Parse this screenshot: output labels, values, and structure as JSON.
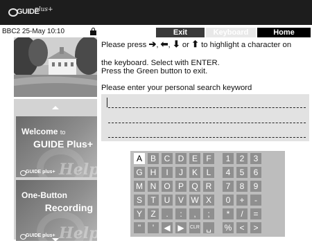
{
  "header": {
    "logo_text": "GUIDE",
    "logo_plus": "plus+"
  },
  "status": {
    "channel_date_time": "BBC2  25-May 10:10"
  },
  "tabs": [
    {
      "label": "Exit"
    },
    {
      "label": "Keyboard"
    },
    {
      "label": "Home"
    }
  ],
  "instruction": {
    "press": "Please press",
    "comma1": ",",
    "comma2": ",",
    "or": "or",
    "rest_line": "to highlight a character on",
    "line2": "the keyboard. Select with ENTER.",
    "line3": "Press the Green button to exit."
  },
  "prompt": "Please enter your personal search keyword",
  "sidebar": {
    "promos": [
      {
        "line1": "Welcome",
        "line1_small": "to",
        "line2": "GUIDE Plus+",
        "logo": "GUIDE plus+",
        "watermark": "Help"
      },
      {
        "line1": "One-Button",
        "line2": "Recording",
        "logo": "GUIDE plus+",
        "watermark": "Help"
      }
    ]
  },
  "keyboard": {
    "selected": "A",
    "rows": [
      [
        "A",
        "B",
        "C",
        "D",
        "E",
        "F",
        "1",
        "2",
        "3"
      ],
      [
        "G",
        "H",
        "I",
        "J",
        "K",
        "L",
        "4",
        "5",
        "6"
      ],
      [
        "M",
        "N",
        "O",
        "P",
        "Q",
        "R",
        "7",
        "8",
        "9"
      ],
      [
        "S",
        "T",
        "U",
        "V",
        "W",
        "X",
        "0",
        "+",
        "-"
      ],
      [
        "Y",
        "Z",
        ".",
        ":",
        ",",
        ";",
        "*",
        "/",
        "="
      ],
      [
        "\"",
        "'",
        "◀",
        "▶",
        "CLR",
        "␣",
        "%",
        "<",
        ">"
      ]
    ]
  }
}
